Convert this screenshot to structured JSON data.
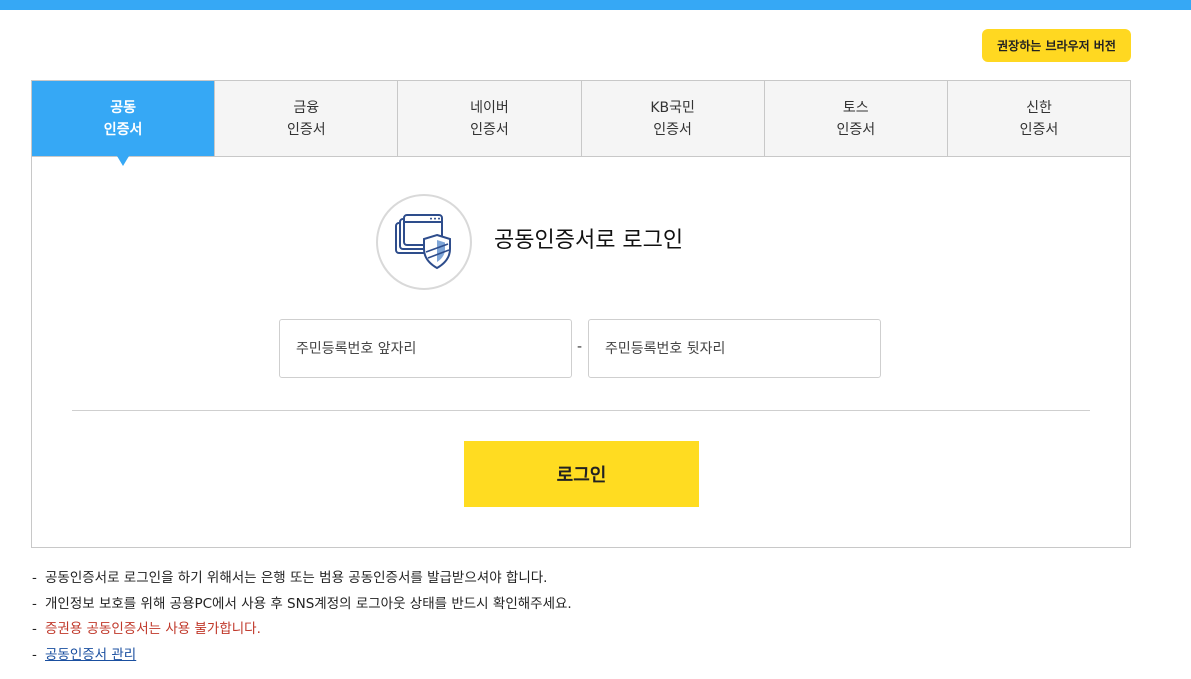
{
  "header": {
    "recommended_browser_label": "권장하는 브라우저 버전"
  },
  "tabs": [
    {
      "line1": "공동",
      "line2": "인증서",
      "active": true
    },
    {
      "line1": "금융",
      "line2": "인증서",
      "active": false
    },
    {
      "line1": "네이버",
      "line2": "인증서",
      "active": false
    },
    {
      "line1": "KB국민",
      "line2": "인증서",
      "active": false
    },
    {
      "line1": "토스",
      "line2": "인증서",
      "active": false
    },
    {
      "line1": "신한",
      "line2": "인증서",
      "active": false
    }
  ],
  "login": {
    "title": "공동인증서로 로그인",
    "icon": "certificate-shield-icon",
    "rrn_front_placeholder": "주민등록번호 앞자리",
    "rrn_separator": "-",
    "rrn_back_placeholder": "주민등록번호 뒷자리",
    "button_label": "로그인"
  },
  "notes": {
    "bullet": "-",
    "items": [
      "공동인증서로 로그인을 하기 위해서는 은행 또는 범용 공동인증서를 발급받으셔야 합니다.",
      "개인정보 보호를 위해 공용PC에서 사용 후 SNS계정의 로그아웃 상태를 반드시 확인해주세요.",
      "증권용 공동인증서는 사용 불가합니다."
    ],
    "manage_link": "공동인증서 관리"
  },
  "colors": {
    "top_bar": "#36a8f5",
    "active_tab": "#36a8f5",
    "login_button": "#ffdc21",
    "warning_text": "#c0392b",
    "link_text": "#1a4fa0"
  }
}
